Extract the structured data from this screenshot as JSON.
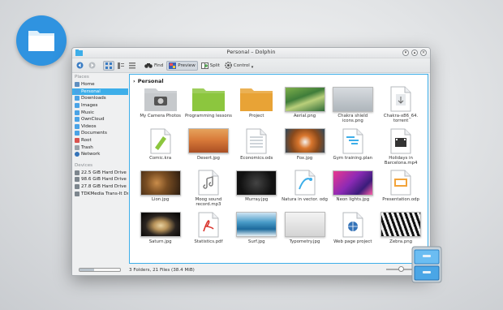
{
  "window": {
    "title": "Personal – Dolphin"
  },
  "toolbar": {
    "find_label": "Find",
    "preview_label": "Preview",
    "split_label": "Split",
    "control_label": "Control"
  },
  "sidebar": {
    "places_header": "Places",
    "places": [
      {
        "label": "Home",
        "icon": "home-icon"
      },
      {
        "label": "Personal",
        "icon": "folder-icon",
        "selected": true
      },
      {
        "label": "Downloads",
        "icon": "downloads-folder-icon"
      },
      {
        "label": "Images",
        "icon": "images-folder-icon"
      },
      {
        "label": "Music",
        "icon": "music-folder-icon"
      },
      {
        "label": "OwnCloud",
        "icon": "cloud-folder-icon"
      },
      {
        "label": "Videos",
        "icon": "videos-folder-icon"
      },
      {
        "label": "Documents",
        "icon": "documents-folder-icon"
      },
      {
        "label": "Root",
        "icon": "root-folder-icon"
      },
      {
        "label": "Trash",
        "icon": "trash-icon"
      },
      {
        "label": "Network",
        "icon": "network-icon"
      }
    ],
    "devices_header": "Devices",
    "devices": [
      {
        "label": "22.5 GiB Hard Drive"
      },
      {
        "label": "98.6 GiB Hard Drive"
      },
      {
        "label": "27.8 GiB Hard Drive"
      },
      {
        "label": "TDKMedia Trans-It Dri"
      }
    ]
  },
  "breadcrumb": {
    "current": "Personal"
  },
  "files": [
    {
      "name": "My Camera Photos",
      "icon": "camera-folder-icon"
    },
    {
      "name": "Programming lessons",
      "icon": "green-folder-icon"
    },
    {
      "name": "Project",
      "icon": "orange-folder-icon"
    },
    {
      "name": "Aerial.png",
      "icon": "aerial-photo-thumbnail"
    },
    {
      "name": "Chakra shield icons.png",
      "icon": "icons-image-thumbnail"
    },
    {
      "name": "Chakra-x86_64. torrent",
      "icon": "torrent-file-icon"
    },
    {
      "name": "Comic.kra",
      "icon": "krita-file-icon"
    },
    {
      "name": "Desert.jpg",
      "icon": "desert-photo-thumbnail"
    },
    {
      "name": "Economics.ods",
      "icon": "spreadsheet-file-icon"
    },
    {
      "name": "Fox.jpg",
      "icon": "fox-photo-thumbnail"
    },
    {
      "name": "Gym training.plan",
      "icon": "plan-file-icon"
    },
    {
      "name": "Holidays in Barcelona.mp4",
      "icon": "video-file-icon"
    },
    {
      "name": "Lion.jpg",
      "icon": "lion-photo-thumbnail"
    },
    {
      "name": "Moog sound record.mp3",
      "icon": "audio-file-icon"
    },
    {
      "name": "Murray.jpg",
      "icon": "murray-photo-thumbnail"
    },
    {
      "name": "Natura in vector. odg",
      "icon": "vector-drawing-file-icon"
    },
    {
      "name": "Neon lights.jpg",
      "icon": "neon-photo-thumbnail"
    },
    {
      "name": "Presentation.odp",
      "icon": "presentation-file-icon"
    },
    {
      "name": "Saturn.jpg",
      "icon": "saturn-photo-thumbnail"
    },
    {
      "name": "Statistics.pdf",
      "icon": "pdf-file-icon"
    },
    {
      "name": "Surf.jpg",
      "icon": "surf-photo-thumbnail"
    },
    {
      "name": "Typometry.jpg",
      "icon": "typometry-photo-thumbnail"
    },
    {
      "name": "Web page project",
      "icon": "html-file-icon"
    },
    {
      "name": "Zebra.png",
      "icon": "zebra-photo-thumbnail"
    }
  ],
  "status": {
    "summary": "3 Folders, 21 Files (38.4 MiB)",
    "free_space_fraction": 0.35,
    "zoom_fraction": 0.45
  },
  "colors": {
    "accent": "#3daee9",
    "badge": "#2f93e0",
    "folder_blue": "#4aa3e6",
    "folder_green": "#8cc63e",
    "folder_orange": "#e8a336"
  }
}
